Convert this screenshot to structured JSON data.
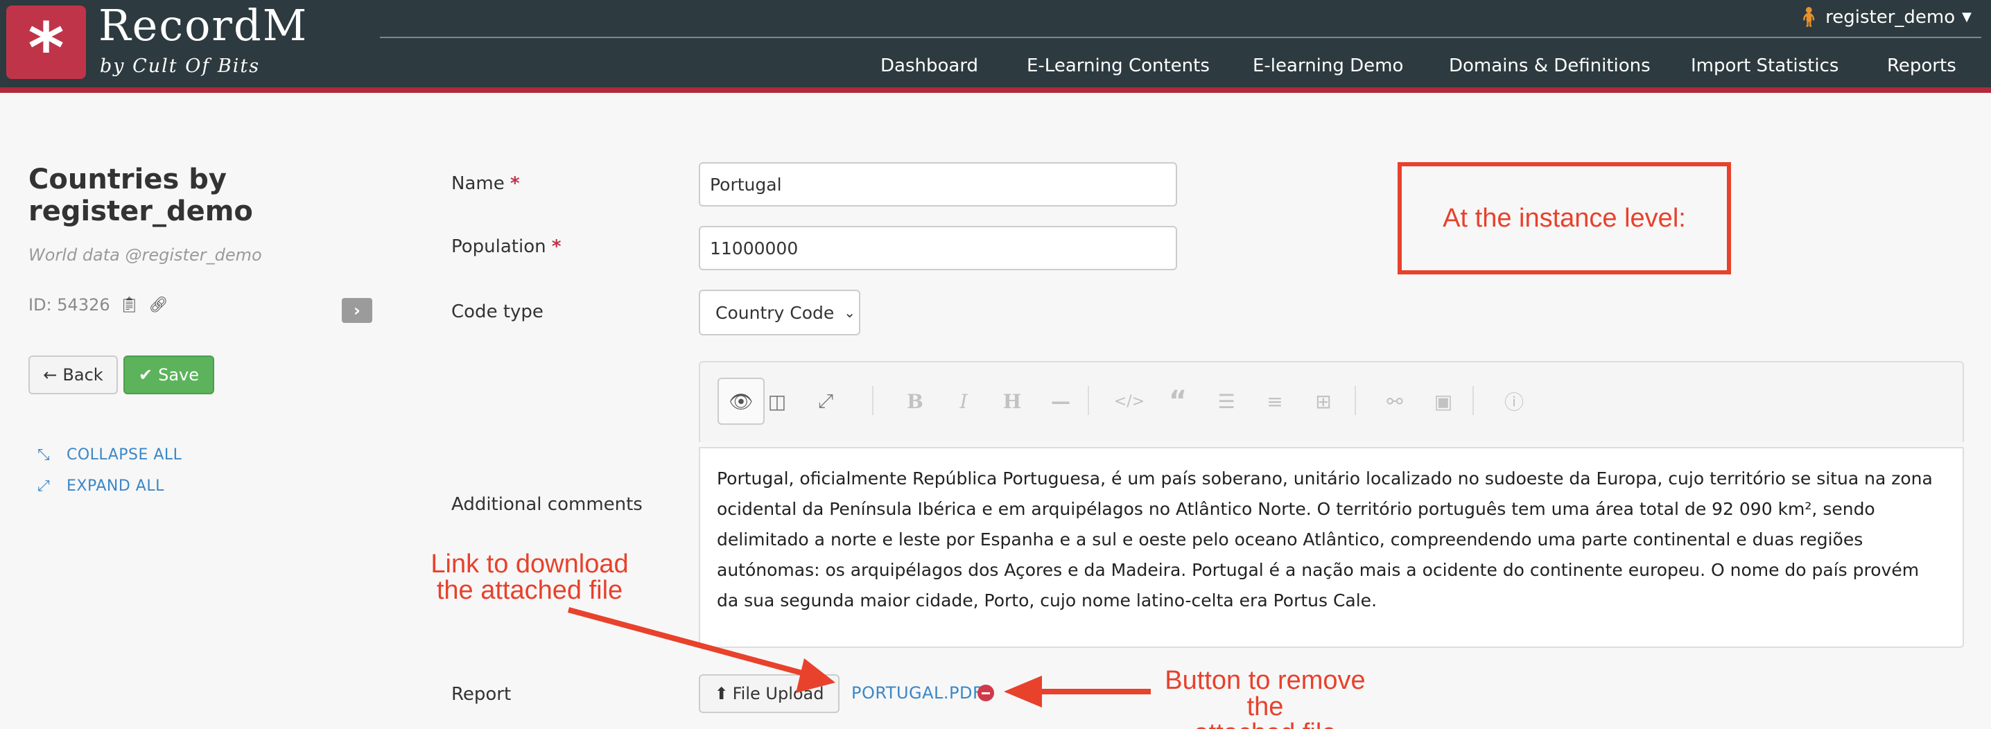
{
  "header": {
    "brand": "RecordM",
    "brand_sub": "by Cult Of Bits",
    "user": "register_demo",
    "nav": [
      "Dashboard",
      "E-Learning Contents",
      "E-learning Demo",
      "Domains & Definitions",
      "Import Statistics",
      "Reports"
    ]
  },
  "sidebar": {
    "title": "Countries by register_demo",
    "subtitle": "World data @register_demo",
    "id_label": "ID: 54326",
    "back_label": "Back",
    "save_label": "Save",
    "collapse_all": "COLLAPSE ALL",
    "expand_all": "EXPAND ALL"
  },
  "form": {
    "name_label": "Name",
    "name_value": "Portugal",
    "population_label": "Population",
    "population_value": "11000000",
    "code_type_label": "Code type",
    "code_type_value": "Country Code",
    "comments_label": "Additional comments",
    "comments_text": "Portugal, oficialmente República Portuguesa, é um país soberano, unitário localizado no sudoeste da Europa, cujo território se situa na zona ocidental da Península Ibérica e em arquipélagos no Atlântico Norte. O território português tem uma área total de 92 090 km², sendo delimitado a norte e leste por Espanha e a sul e oeste pelo oceano Atlântico, compreendendo uma parte continental e duas regiões autónomas: os arquipélagos dos Açores e da Madeira. Portugal é a nação mais a ocidente do continente europeu. O nome do país provém da sua segunda maior cidade, Porto, cujo nome latino-celta era Portus Cale.",
    "report_label": "Report",
    "file_upload_label": "File Upload",
    "file_name": "PORTUGAL.PDF",
    "required_mark": "*"
  },
  "annotations": {
    "instance_level": "At the instance level:",
    "download_line1": "Link to download",
    "download_line2": "the attached file",
    "remove_line1": "Button to remove the",
    "remove_line2": "attached file"
  },
  "colors": {
    "header_bg": "#2d3a3f",
    "brand_red": "#c0344a",
    "save_green": "#5cb35c",
    "link_blue": "#3a87c7",
    "annotation_red": "#e8412c"
  },
  "icons": {
    "logo": "asterisk-icon",
    "user": "user-icon",
    "copy": "clipboard-icon",
    "link": "link-icon",
    "chevron": "chevron-right-icon",
    "back": "arrow-left-icon",
    "save": "checkmark-icon",
    "collapse": "compress-icon",
    "expand": "expand-icon",
    "upload": "upload-circle-icon",
    "remove": "minus-circle-icon"
  }
}
